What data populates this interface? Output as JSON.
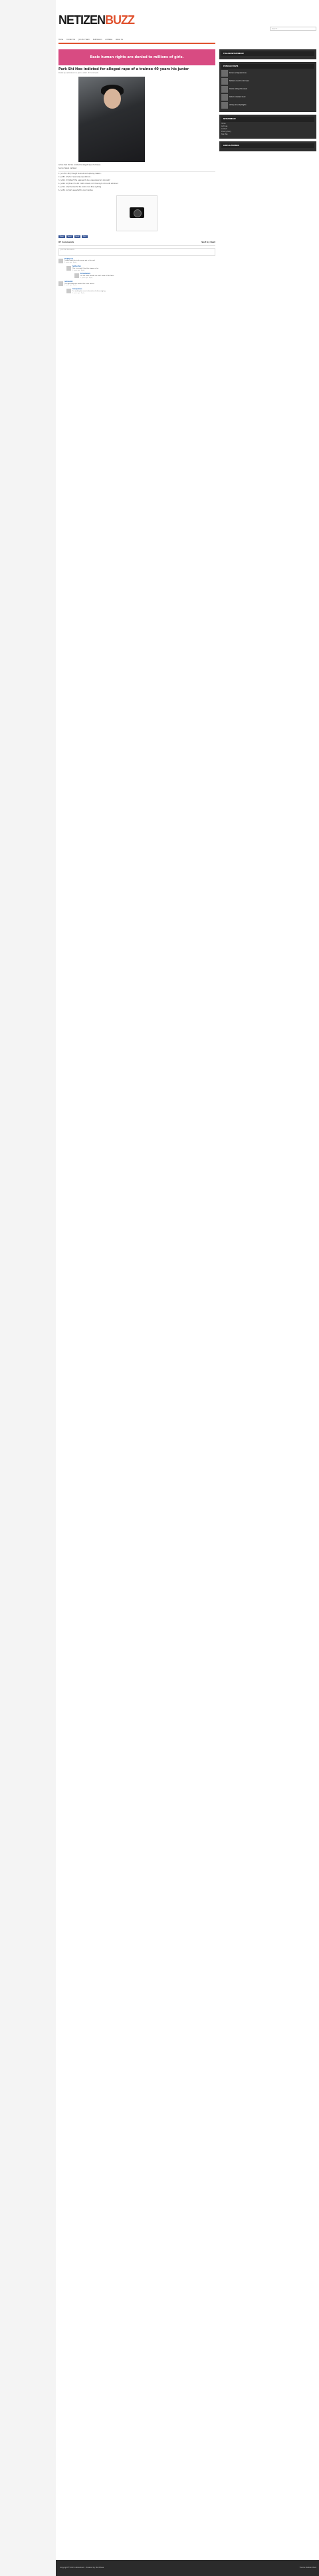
{
  "site": {
    "logo_left": "NETIZEN",
    "logo_right": "BUZZ",
    "search_placeholder": "Search..."
  },
  "nav": [
    "Home",
    "Contact Us",
    "Join Our Team",
    "Submission",
    "Ad Rates",
    "About Us"
  ],
  "ad_text": "Basic human rights are denied to millions of girls.",
  "article": {
    "title": "Park Shi Hoo indicted for alleged rape of a trainee 40 years his junior",
    "meta": "Posted by netizenbuzz on April 2, 2013 · 87 Comments",
    "paragraphs": [
      "Article: Park Shi Hoo indicted for alleged rape of a trainee",
      "Source: News1 via Naver",
      "1. [+1,234, -86] I thought he would end up being cleared...",
      "2. [+987, -45] So it was really rape after all...",
      "3. [+812, -33] Wasn't this supposed to be a case where he's innocent?",
      "4. [+640, -20] Even if he did it with consent, isn't it wrong to drink with a trainee?",
      "5. [+512, -18] I feel bad for the victim more than anything",
      "6. [+450, -12] Let's see what the court decides"
    ],
    "share": [
      "Share",
      "Tweet",
      "Email",
      "Print"
    ]
  },
  "comments_header": {
    "count": "87 Comments",
    "sort": "Sort by Best"
  },
  "comment_box_placeholder": "Join the discussion...",
  "comments": [
    {
      "name": "PinkPanda",
      "text": "I really hope the truth comes out in the end.",
      "foot": "2 years ago · Reply"
    },
    {
      "name": "hallyu_fan",
      "text": "This is so sad, I liked his dramas a lot.",
      "foot": "2 years ago · Reply"
    },
    {
      "name": "koreanwave",
      "text": "Let the court decide, we don't know all the facts.",
      "foot": "2 years ago · Reply"
    },
    {
      "name": "netizen88",
      "text": "The age difference makes this even worse...",
      "foot": "2 years ago · Reply"
    },
    {
      "name": "Anonymous",
      "text": "I'm waiting for more information before judging.",
      "foot": "2 years ago · Reply"
    }
  ],
  "sidebar": {
    "follow_head": "FOLLOW NETIZENBUZZ",
    "popular_head": "POPULAR POSTS",
    "popular": [
      "Korean ad appearances",
      "Netizens react to idol news",
      "Drama ratings this week",
      "Debut comeback buzz",
      "Variety show highlights"
    ],
    "archives_head": "NETIZENBUZZ",
    "archives": [
      "Home",
      "Archives",
      "Contact",
      "Privacy Policy",
      "Site Map"
    ],
    "links_head": "LINKS & FRIENDS"
  },
  "footer": {
    "left": "Copyright © 2013 netizenbuzz · Powered by WordPress",
    "right": "Theme: Netizen Buzz"
  }
}
